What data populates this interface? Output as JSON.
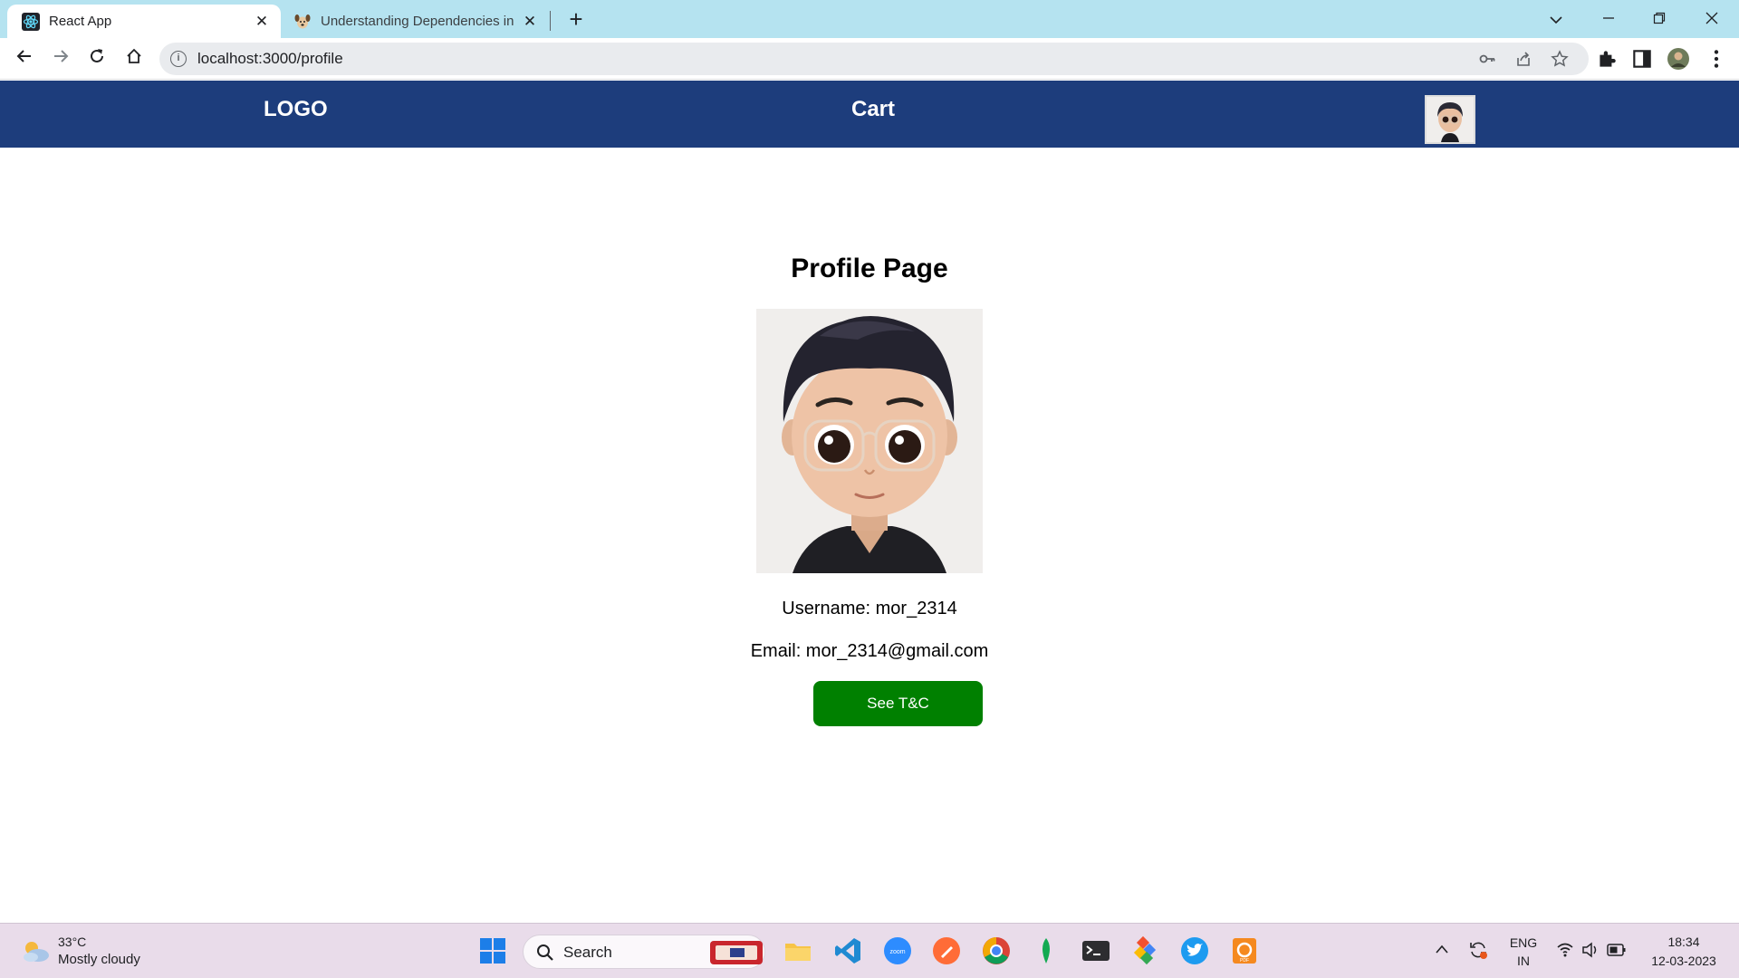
{
  "browser": {
    "tabs": [
      {
        "title": "React App",
        "favicon": "react-icon",
        "active": true
      },
      {
        "title": "Understanding Dependencies in",
        "favicon": "dog-icon",
        "active": false
      }
    ],
    "url": "localhost:3000/profile"
  },
  "navbar": {
    "logo": "LOGO",
    "cart": "Cart",
    "avatar": "avatar-icon",
    "background": "#1d3d7c"
  },
  "profile": {
    "heading": "Profile Page",
    "username_line": "Username: mor_2314",
    "email_line": "Email: mor_2314@gmail.com",
    "tc_button": "See T&C",
    "button_color": "#008000"
  },
  "taskbar": {
    "weather_temp": "33°C",
    "weather_desc": "Mostly cloudy",
    "search_label": "Search",
    "lang_top": "ENG",
    "lang_bottom": "IN",
    "time": "18:34",
    "date": "12-03-2023",
    "apps": [
      "windows-start-icon",
      "file-explorer-icon",
      "vscode-icon",
      "zoom-icon",
      "postman-icon",
      "chrome-icon",
      "mongodb-icon",
      "terminal-icon",
      "git-icon",
      "twitter-icon",
      "pdf-icon"
    ]
  }
}
